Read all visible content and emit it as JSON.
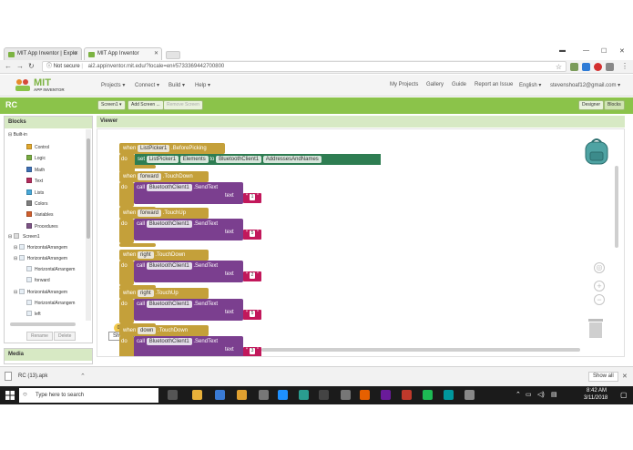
{
  "browser": {
    "tabs": [
      {
        "label": "MIT App Inventor | Explo",
        "active": false
      },
      {
        "label": "MIT App Inventor",
        "active": true
      }
    ],
    "security": "Not secure",
    "url": "ai2.appinventor.mit.edu/?locale=en#5733369442700800"
  },
  "app": {
    "logo_top": "MIT",
    "logo_bottom": "APP INVENTOR",
    "menus": [
      "Projects ▾",
      "Connect ▾",
      "Build ▾",
      "Help ▾"
    ],
    "right_menus": [
      "My Projects",
      "Gallery",
      "Guide",
      "Report an Issue",
      "English ▾",
      "stevenshoaf12@gmail.com ▾"
    ]
  },
  "project": {
    "name": "RC",
    "screen_button": "Screen1 ▾",
    "add_screen": "Add Screen ...",
    "remove_screen": "Remove Screen",
    "designer": "Designer",
    "blocks": "Blocks"
  },
  "blocks_panel": {
    "title": "Blocks",
    "builtin_label": "Built-in",
    "builtin": [
      {
        "label": "Control",
        "color": "#e1a82e"
      },
      {
        "label": "Logic",
        "color": "#77ab41"
      },
      {
        "label": "Math",
        "color": "#3f71b5"
      },
      {
        "label": "Text",
        "color": "#b32d5e"
      },
      {
        "label": "Lists",
        "color": "#48a8d8"
      },
      {
        "label": "Colors",
        "color": "#7d7d7d"
      },
      {
        "label": "Variables",
        "color": "#d05f2d"
      },
      {
        "label": "Procedures",
        "color": "#7c5385"
      }
    ],
    "screen_label": "Screen1",
    "components": [
      "HorizontalArrangem",
      "HorizontalArrangem",
      "HorizontalArrangem",
      "forward",
      "HorizontalArrangem",
      "HorizontalArrangem",
      "left"
    ],
    "rename": "Rename",
    "delete": "Delete"
  },
  "media_panel": {
    "title": "Media"
  },
  "viewer": {
    "title": "Viewer",
    "kw_when": "when",
    "kw_do": "do",
    "kw_set": "set",
    "kw_to": "to",
    "kw_call": "call",
    "kw_text": "text",
    "listpicker": {
      "component": "ListPicker1",
      "event": ".BeforePicking",
      "prop": "Elements",
      "source": "BluetoothClient1",
      "source_prop": "AddressesAndNames"
    },
    "handlers": [
      {
        "button": "forward",
        "event": ".TouchDown",
        "client": "BluetoothClient1",
        "method": ".SendText",
        "value": "1"
      },
      {
        "button": "forward",
        "event": ".TouchUp",
        "client": "BluetoothClient1",
        "method": ".SendText",
        "value": "5"
      },
      {
        "button": "right",
        "event": ".TouchDown",
        "client": "BluetoothClient1",
        "method": ".SendText",
        "value": "2"
      },
      {
        "button": "right",
        "event": ".TouchUp",
        "client": "BluetoothClient1",
        "method": ".SendText",
        "value": "5"
      },
      {
        "button": "down",
        "event": ".TouchDown",
        "client": "BluetoothClient1",
        "method": ".SendText",
        "value": "3"
      }
    ],
    "warn_count": "0",
    "error_count": "0",
    "show_warnings": "Show Warnings"
  },
  "download": {
    "file": "RC (13).apk",
    "show_all": "Show all"
  },
  "taskbar": {
    "search": "Type here to search",
    "time": "8:42 AM",
    "date": "3/11/2018"
  }
}
